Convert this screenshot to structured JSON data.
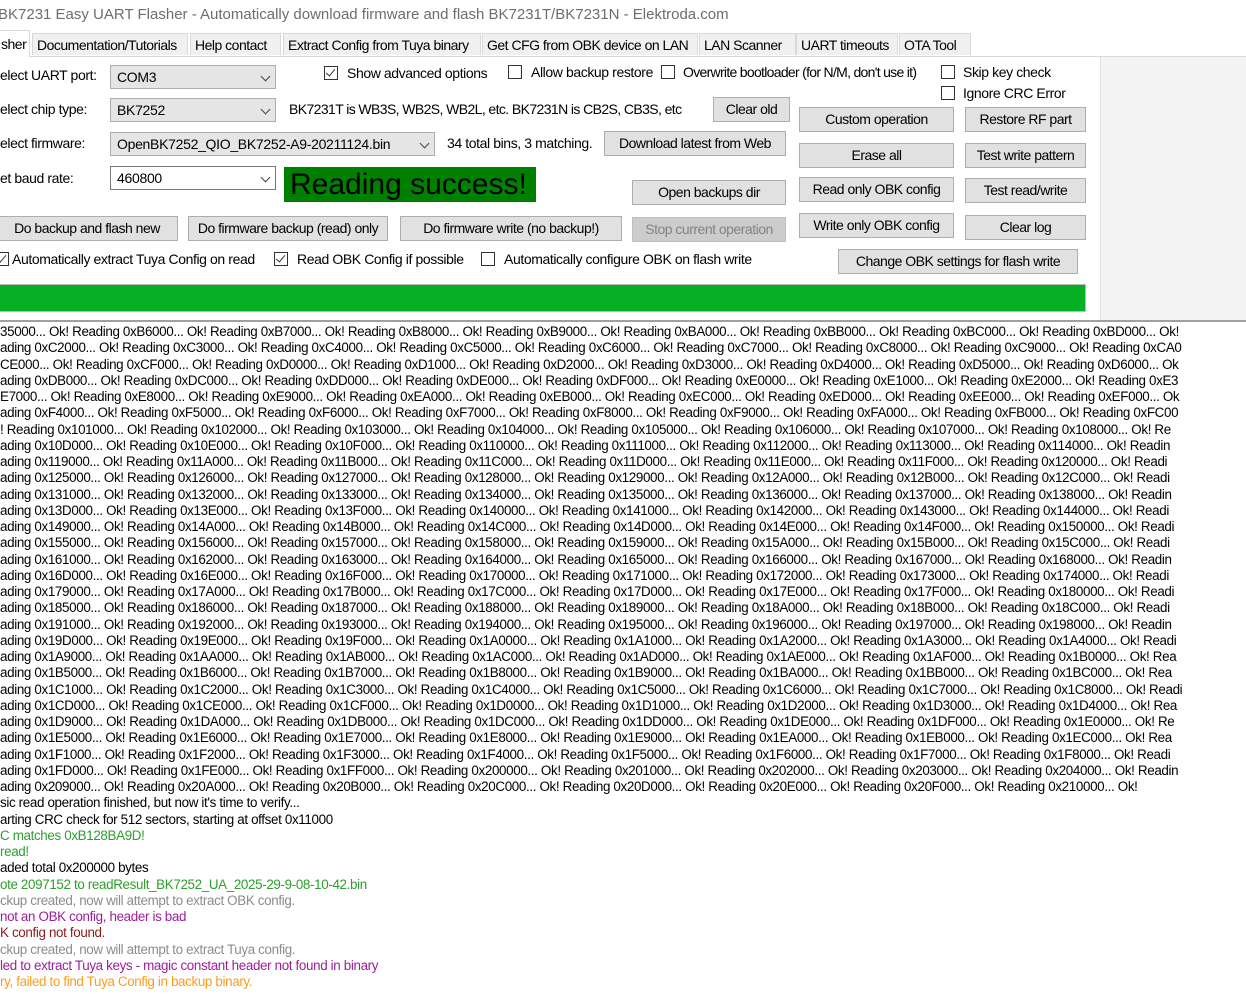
{
  "window": {
    "title": "BK7231 Easy UART Flasher - Automatically download firmware and flash BK7231T/BK7231N  - Elektroda.com"
  },
  "tabs": [
    {
      "label": "sher",
      "active": true
    },
    {
      "label": "Documentation/Tutorials"
    },
    {
      "label": "Help contact"
    },
    {
      "label": "Extract Config from Tuya binary"
    },
    {
      "label": "Get CFG from OBK device on LAN"
    },
    {
      "label": "LAN Scanner"
    },
    {
      "label": "UART timeouts"
    },
    {
      "label": "OTA Tool"
    }
  ],
  "form": {
    "uart_label": "elect UART port:",
    "uart_value": "COM3",
    "chip_label": "elect chip type:",
    "chip_value": "BK7252",
    "chip_info": "BK7231T is WB3S, WB2S, WB2L, etc. BK7231N is CB2S, CB3S, etc",
    "firmware_label": "elect firmware:",
    "firmware_value": "OpenBK7252_QIO_BK7252-A9-20211124.bin",
    "firmware_info": "34 total bins, 3 matching.",
    "baud_label": "et baud rate:",
    "baud_value": "460800",
    "status_text": "Reading success!",
    "status_color": "#008000"
  },
  "checkboxes": {
    "show_advanced": {
      "label": "Show advanced options",
      "checked": true
    },
    "allow_backup_restore": {
      "label": "Allow backup restore",
      "checked": false
    },
    "overwrite_bootloader": {
      "label": "Overwrite bootloader (for N/M, don't use it)",
      "checked": false
    },
    "skip_key_check": {
      "label": "Skip key check",
      "checked": false
    },
    "ignore_crc": {
      "label": "Ignore CRC Error",
      "checked": false
    },
    "auto_extract_tuya": {
      "label": "Automatically extract Tuya Config on read",
      "checked": true
    },
    "read_obk_config": {
      "label": "Read OBK Config if possible",
      "checked": true
    },
    "auto_configure_obk": {
      "label": "Automatically configure OBK on flash write",
      "checked": false
    }
  },
  "buttons": {
    "clear_old": "Clear old",
    "download_latest": "Download latest from Web",
    "open_backups": "Open backups dir",
    "backup_and_flash": "Do backup and flash new",
    "backup_only": "Do firmware backup (read) only",
    "write_only": "Do firmware write (no backup!)",
    "stop": "Stop current operation",
    "custom_operation": "Custom operation",
    "restore_rf": "Restore RF part",
    "erase_all": "Erase all",
    "test_write_pattern": "Test write pattern",
    "read_obk_config": "Read only OBK config",
    "test_read_write": "Test read/write",
    "write_obk_config": "Write only OBK config",
    "clear_log": "Clear log",
    "change_obk_settings": "Change OBK settings for flash write"
  },
  "progress": {
    "percent": 100,
    "color": "#06b025"
  },
  "log": [
    {
      "text": "35000... Ok! Reading 0xB6000... Ok! Reading 0xB7000... Ok! Reading 0xB8000... Ok! Reading 0xB9000... Ok! Reading 0xBA000... Ok! Reading 0xBB000... Ok! Reading 0xBC000... Ok! Reading 0xBD000... Ok!",
      "color": "#000000"
    },
    {
      "text": "ading 0xC2000... Ok! Reading 0xC3000... Ok! Reading 0xC4000... Ok! Reading 0xC5000... Ok! Reading 0xC6000... Ok! Reading 0xC7000... Ok! Reading 0xC8000... Ok! Reading 0xC9000... Ok! Reading 0xCA0",
      "color": "#000000"
    },
    {
      "text": "CE000... Ok! Reading 0xCF000... Ok! Reading 0xD0000... Ok! Reading 0xD1000... Ok! Reading 0xD2000... Ok! Reading 0xD3000... Ok! Reading 0xD4000... Ok! Reading 0xD5000... Ok! Reading 0xD6000... Ok",
      "color": "#000000"
    },
    {
      "text": "ading 0xDB000... Ok! Reading 0xDC000... Ok! Reading 0xDD000... Ok! Reading 0xDE000... Ok! Reading 0xDF000... Ok! Reading 0xE0000... Ok! Reading 0xE1000... Ok! Reading 0xE2000... Ok! Reading 0xE3",
      "color": "#000000"
    },
    {
      "text": "E7000... Ok! Reading 0xE8000... Ok! Reading 0xE9000... Ok! Reading 0xEA000... Ok! Reading 0xEB000... Ok! Reading 0xEC000... Ok! Reading 0xED000... Ok! Reading 0xEE000... Ok! Reading 0xEF000... Ok",
      "color": "#000000"
    },
    {
      "text": "ading 0xF4000... Ok! Reading 0xF5000... Ok! Reading 0xF6000... Ok! Reading 0xF7000... Ok! Reading 0xF8000... Ok! Reading 0xF9000... Ok! Reading 0xFA000... Ok! Reading 0xFB000... Ok! Reading 0xFC00",
      "color": "#000000"
    },
    {
      "text": "! Reading 0x101000... Ok! Reading 0x102000... Ok! Reading 0x103000... Ok! Reading 0x104000... Ok! Reading 0x105000... Ok! Reading 0x106000... Ok! Reading 0x107000... Ok! Reading 0x108000... Ok! Re",
      "color": "#000000"
    },
    {
      "text": "ading 0x10D000... Ok! Reading 0x10E000... Ok! Reading 0x10F000... Ok! Reading 0x110000... Ok! Reading 0x111000... Ok! Reading 0x112000... Ok! Reading 0x113000... Ok! Reading 0x114000... Ok! Readin",
      "color": "#000000"
    },
    {
      "text": "ading 0x119000... Ok! Reading 0x11A000... Ok! Reading 0x11B000... Ok! Reading 0x11C000... Ok! Reading 0x11D000... Ok! Reading 0x11E000... Ok! Reading 0x11F000... Ok! Reading 0x120000... Ok! Readi",
      "color": "#000000"
    },
    {
      "text": "ading 0x125000... Ok! Reading 0x126000... Ok! Reading 0x127000... Ok! Reading 0x128000... Ok! Reading 0x129000... Ok! Reading 0x12A000... Ok! Reading 0x12B000... Ok! Reading 0x12C000... Ok! Readi",
      "color": "#000000"
    },
    {
      "text": "ading 0x131000... Ok! Reading 0x132000... Ok! Reading 0x133000... Ok! Reading 0x134000... Ok! Reading 0x135000... Ok! Reading 0x136000... Ok! Reading 0x137000... Ok! Reading 0x138000... Ok! Readin",
      "color": "#000000"
    },
    {
      "text": "ading 0x13D000... Ok! Reading 0x13E000... Ok! Reading 0x13F000... Ok! Reading 0x140000... Ok! Reading 0x141000... Ok! Reading 0x142000... Ok! Reading 0x143000... Ok! Reading 0x144000... Ok! Readi",
      "color": "#000000"
    },
    {
      "text": "ading 0x149000... Ok! Reading 0x14A000... Ok! Reading 0x14B000... Ok! Reading 0x14C000... Ok! Reading 0x14D000... Ok! Reading 0x14E000... Ok! Reading 0x14F000... Ok! Reading 0x150000... Ok! Readi",
      "color": "#000000"
    },
    {
      "text": "ading 0x155000... Ok! Reading 0x156000... Ok! Reading 0x157000... Ok! Reading 0x158000... Ok! Reading 0x159000... Ok! Reading 0x15A000... Ok! Reading 0x15B000... Ok! Reading 0x15C000... Ok! Readi",
      "color": "#000000"
    },
    {
      "text": "ading 0x161000... Ok! Reading 0x162000... Ok! Reading 0x163000... Ok! Reading 0x164000... Ok! Reading 0x165000... Ok! Reading 0x166000... Ok! Reading 0x167000... Ok! Reading 0x168000... Ok! Readin",
      "color": "#000000"
    },
    {
      "text": "ading 0x16D000... Ok! Reading 0x16E000... Ok! Reading 0x16F000... Ok! Reading 0x170000... Ok! Reading 0x171000... Ok! Reading 0x172000... Ok! Reading 0x173000... Ok! Reading 0x174000... Ok! Readi",
      "color": "#000000"
    },
    {
      "text": "ading 0x179000... Ok! Reading 0x17A000... Ok! Reading 0x17B000... Ok! Reading 0x17C000... Ok! Reading 0x17D000... Ok! Reading 0x17E000... Ok! Reading 0x17F000... Ok! Reading 0x180000... Ok! Readi",
      "color": "#000000"
    },
    {
      "text": "ading 0x185000... Ok! Reading 0x186000... Ok! Reading 0x187000... Ok! Reading 0x188000... Ok! Reading 0x189000... Ok! Reading 0x18A000... Ok! Reading 0x18B000... Ok! Reading 0x18C000... Ok! Readi",
      "color": "#000000"
    },
    {
      "text": "ading 0x191000... Ok! Reading 0x192000... Ok! Reading 0x193000... Ok! Reading 0x194000... Ok! Reading 0x195000... Ok! Reading 0x196000... Ok! Reading 0x197000... Ok! Reading 0x198000... Ok! Readin",
      "color": "#000000"
    },
    {
      "text": "ading 0x19D000... Ok! Reading 0x19E000... Ok! Reading 0x19F000... Ok! Reading 0x1A0000... Ok! Reading 0x1A1000... Ok! Reading 0x1A2000... Ok! Reading 0x1A3000... Ok! Reading 0x1A4000... Ok! Readi",
      "color": "#000000"
    },
    {
      "text": "ading 0x1A9000... Ok! Reading 0x1AA000... Ok! Reading 0x1AB000... Ok! Reading 0x1AC000... Ok! Reading 0x1AD000... Ok! Reading 0x1AE000... Ok! Reading 0x1AF000... Ok! Reading 0x1B0000... Ok! Rea",
      "color": "#000000"
    },
    {
      "text": "ading 0x1B5000... Ok! Reading 0x1B6000... Ok! Reading 0x1B7000... Ok! Reading 0x1B8000... Ok! Reading 0x1B9000... Ok! Reading 0x1BA000... Ok! Reading 0x1BB000... Ok! Reading 0x1BC000... Ok! Rea",
      "color": "#000000"
    },
    {
      "text": "ading 0x1C1000... Ok! Reading 0x1C2000... Ok! Reading 0x1C3000... Ok! Reading 0x1C4000... Ok! Reading 0x1C5000... Ok! Reading 0x1C6000... Ok! Reading 0x1C7000... Ok! Reading 0x1C8000... Ok! Readi",
      "color": "#000000"
    },
    {
      "text": "ading 0x1CD000... Ok! Reading 0x1CE000... Ok! Reading 0x1CF000... Ok! Reading 0x1D0000... Ok! Reading 0x1D1000... Ok! Reading 0x1D2000... Ok! Reading 0x1D3000... Ok! Reading 0x1D4000... Ok! Rea",
      "color": "#000000"
    },
    {
      "text": "ading 0x1D9000... Ok! Reading 0x1DA000... Ok! Reading 0x1DB000... Ok! Reading 0x1DC000... Ok! Reading 0x1DD000... Ok! Reading 0x1DE000... Ok! Reading 0x1DF000... Ok! Reading 0x1E0000... Ok! Re",
      "color": "#000000"
    },
    {
      "text": "ading 0x1E5000... Ok! Reading 0x1E6000... Ok! Reading 0x1E7000... Ok! Reading 0x1E8000... Ok! Reading 0x1E9000... Ok! Reading 0x1EA000... Ok! Reading 0x1EB000... Ok! Reading 0x1EC000... Ok! Rea",
      "color": "#000000"
    },
    {
      "text": "ading 0x1F1000... Ok! Reading 0x1F2000... Ok! Reading 0x1F3000... Ok! Reading 0x1F4000... Ok! Reading 0x1F5000... Ok! Reading 0x1F6000... Ok! Reading 0x1F7000... Ok! Reading 0x1F8000... Ok! Readi",
      "color": "#000000"
    },
    {
      "text": "ading 0x1FD000... Ok! Reading 0x1FE000... Ok! Reading 0x1FF000... Ok! Reading 0x200000... Ok! Reading 0x201000... Ok! Reading 0x202000... Ok! Reading 0x203000... Ok! Reading 0x204000... Ok! Readin",
      "color": "#000000"
    },
    {
      "text": "ading 0x209000... Ok! Reading 0x20A000... Ok! Reading 0x20B000... Ok! Reading 0x20C000... Ok! Reading 0x20D000... Ok! Reading 0x20E000... Ok! Reading 0x20F000... Ok! Reading 0x210000... Ok!",
      "color": "#000000"
    },
    {
      "text": "sic read operation finished, but now it's time to verify...",
      "color": "#000000"
    },
    {
      "text": "arting CRC check for 512 sectors, starting at offset 0x11000",
      "color": "#000000"
    },
    {
      "text": "C matches 0xB128BA9D!",
      "color": "#2e9e2e"
    },
    {
      "text": "read!",
      "color": "#2e9e2e"
    },
    {
      "text": "aded total 0x200000 bytes",
      "color": "#000000"
    },
    {
      "text": "ote 2097152 to readResult_BK7252_UA_2025-29-9-08-10-42.bin",
      "color": "#2e9e2e"
    },
    {
      "text": "ckup created, now will attempt to extract OBK config.",
      "color": "#8c8c8c"
    },
    {
      "text": " not an OBK config, header is bad",
      "color": "#9b1f9b"
    },
    {
      "text": "K config not found.",
      "color": "#8b1a1a"
    },
    {
      "text": "ckup created, now will attempt to extract Tuya config.",
      "color": "#8c8c8c"
    },
    {
      "text": "led to extract Tuya keys - magic constant header not found in binary",
      "color": "#9b1f9b"
    },
    {
      "text": "ry, failed to find Tuya Config in backup binary.",
      "color": "#ff9a1f"
    }
  ]
}
